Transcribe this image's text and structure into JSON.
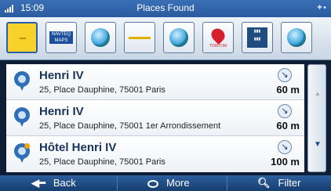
{
  "status": {
    "time": "15:09",
    "title": "Places Found",
    "gps_icon": "gps-satellite-icon"
  },
  "categories": [
    {
      "icon": "all-categories-icon",
      "selected": true
    },
    {
      "icon": "navteq-maps-icon",
      "label": "NAVTEQ MAPS"
    },
    {
      "icon": "globe-icon"
    },
    {
      "icon": "road-line-icon"
    },
    {
      "icon": "globe-icon"
    },
    {
      "icon": "tomtom-icon",
      "label": "TOMTOM"
    },
    {
      "icon": "building-icon"
    },
    {
      "icon": "globe-icon"
    }
  ],
  "results": [
    {
      "name": "Henri IV",
      "address": "25, Place Dauphine, 75001 Paris",
      "distance": "60 m",
      "icon": "location-pin-icon"
    },
    {
      "name": "Henri IV",
      "address": "25, Place Dauphine, 75001 1er Arrondissement",
      "distance": "60 m",
      "icon": "location-pin-icon"
    },
    {
      "name": "Hôtel Henri IV",
      "address": "25, Place Dauphine, 75001 Paris",
      "distance": "100 m",
      "icon": "location-pin-star-icon"
    }
  ],
  "colors": {
    "accent": "#2a5aa0",
    "selected_category": "#f6d22b",
    "pin": "#2f6fb8"
  },
  "bottom": {
    "back": "Back",
    "more": "More",
    "filter": "Filter"
  }
}
